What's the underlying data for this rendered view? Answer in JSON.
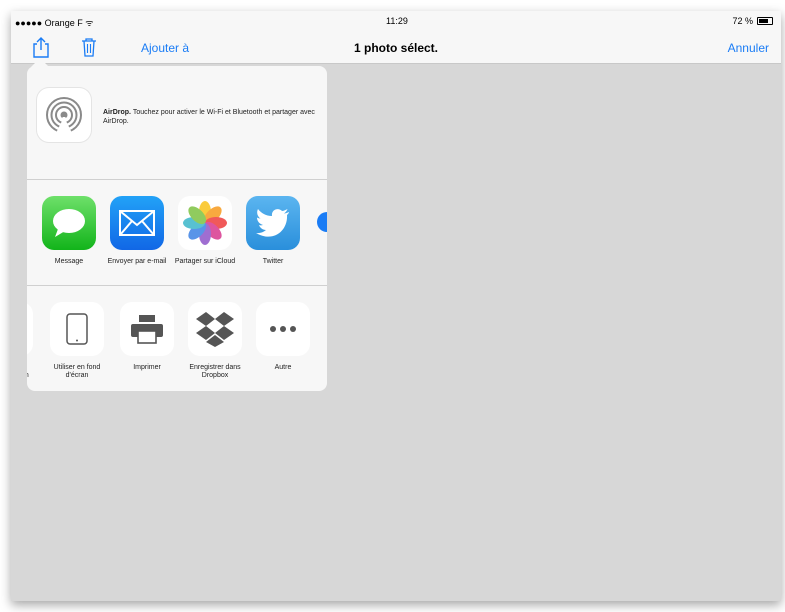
{
  "status_bar": {
    "carrier": "●●●●● Orange F ᯤ",
    "time": "11:29",
    "battery": "72 %"
  },
  "navbar": {
    "add_to": "Ajouter à",
    "title": "1 photo sélect.",
    "cancel": "Annuler"
  },
  "airdrop": {
    "bold": "AirDrop.",
    "text": " Touchez pour activer le Wi-Fi et Bluetooth et partager avec AirDrop."
  },
  "apps": [
    {
      "label": "Message",
      "icon": "messages-icon"
    },
    {
      "label": "Envoyer par e-mail",
      "icon": "mail-icon"
    },
    {
      "label": "Partager sur iCloud",
      "icon": "photos-icon"
    },
    {
      "label": "Twitter",
      "icon": "twitter-icon"
    }
  ],
  "actions": {
    "partial": "un",
    "items": [
      {
        "label": "Utiliser en fond d'écran",
        "icon": "ipad-icon"
      },
      {
        "label": "Imprimer",
        "icon": "printer-icon"
      },
      {
        "label": "Enregistrer dans Dropbox",
        "icon": "dropbox-icon"
      },
      {
        "label": "Autre",
        "icon": "more-icon"
      }
    ]
  },
  "colors": {
    "accent": "#1a7cf5",
    "background": "#d7d7d7",
    "bar": "#f7f7f7"
  }
}
